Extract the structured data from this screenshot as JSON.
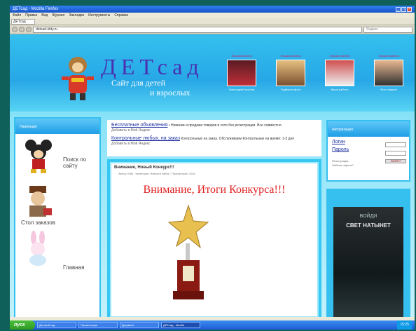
{
  "window": {
    "title": "ДЕТсад - Mozilla Firefox"
  },
  "menu": [
    "Файл",
    "Правка",
    "Вид",
    "Журнал",
    "Закладки",
    "Инструменты",
    "Справка"
  ],
  "tab": {
    "label": "ДЕТсад"
  },
  "address": {
    "value": "detsad-kitty.ru",
    "search_placeholder": "Яндекс"
  },
  "banner": {
    "title": "ДЕТсад",
    "tagline1": "Сайт для детей",
    "tagline2": "и взрослых",
    "thumbs": [
      {
        "caption": "Лучшие работы",
        "sub": "Новогодний костюм"
      },
      {
        "caption": "Лучшие работы",
        "sub": "Подборка фото"
      },
      {
        "caption": "Лучшие работы",
        "sub": "Ваши работы"
      },
      {
        "caption": "Лучшие работы",
        "sub": "Фото недели"
      }
    ]
  },
  "left": {
    "header": "Навигация",
    "items": [
      {
        "label": "Поиск по сайту"
      },
      {
        "label": "Стол заказов"
      },
      {
        "label": "Главная"
      }
    ]
  },
  "ads": [
    {
      "link": "Бесплатные объявления",
      "text": "• Новинки и продажи товаров в сети без регистрации. Все совместно.",
      "note": "Добавить в Мой Яндекс"
    },
    {
      "link": "Контрольные любых, на заказ",
      "text": "Контрольные на заказ. Обслуживаем Контрольные на время: 1-3 дня",
      "note": "Добавить в Мой Яндекс"
    }
  ],
  "post": {
    "title": "Внимание, Новый Конкурс!!!",
    "meta": "Автор: Kitty · Категория: Новости сайта · Просмотров: 1044",
    "headline": "Внимание, Итоги Конкурса!!!"
  },
  "login": {
    "header": "Авторизация",
    "login_label": "Логин",
    "password_label": "Пароль",
    "button": "ВОЙТИ",
    "notes": [
      "Регистрация",
      "Забыли пароль?"
    ]
  },
  "poster": {
    "line1": "ВОЙДИ",
    "line2": "СВЕТ НАТЫНЕТ"
  },
  "taskbar": {
    "start": "пуск",
    "tasks": [
      "Детский сад",
      "Презентация",
      "Документ",
      "ДЕТсад - Mozilla"
    ],
    "clock": "15:25"
  }
}
